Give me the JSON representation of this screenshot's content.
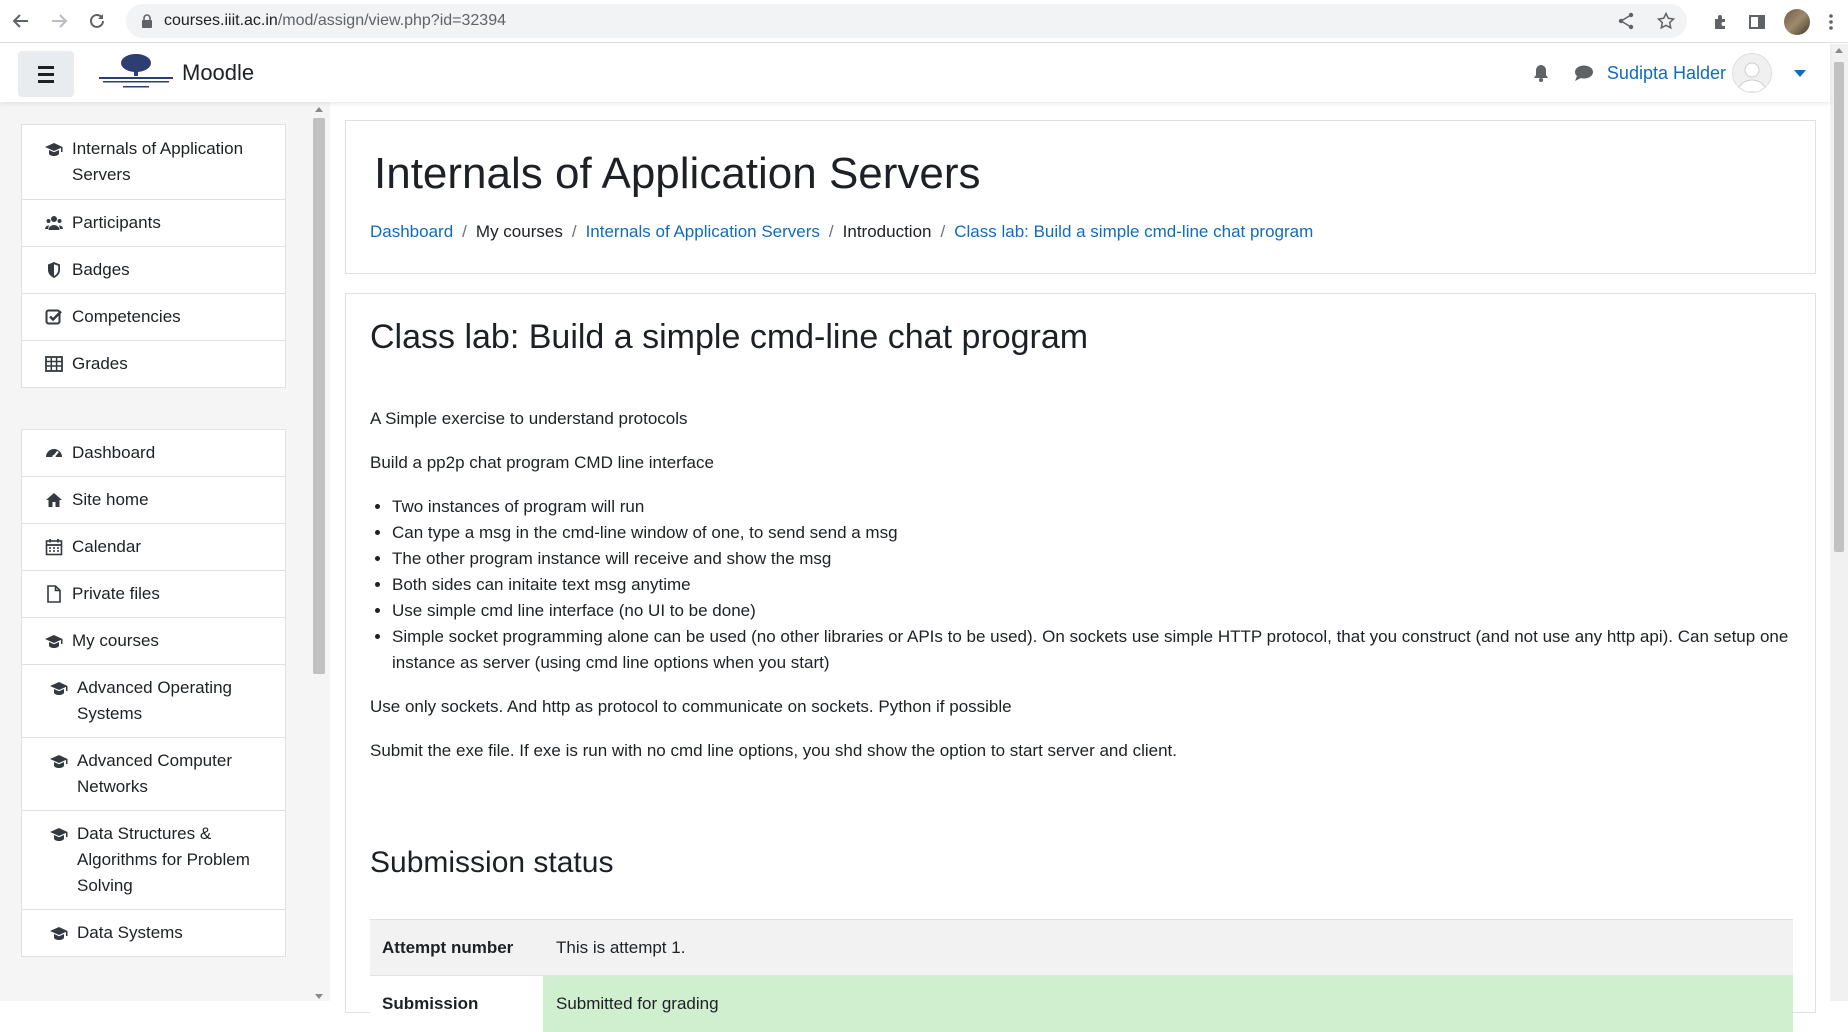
{
  "browser": {
    "url_host": "courses.iiit.ac.in",
    "url_path": "/mod/assign/view.php?id=32394"
  },
  "navbar": {
    "site_name": "Moodle",
    "user_name": "Sudipta Halder"
  },
  "drawer": {
    "course_items": [
      {
        "label": "Internals of Application Servers",
        "icon": "graduation-cap-icon"
      },
      {
        "label": "Participants",
        "icon": "users-icon"
      },
      {
        "label": "Badges",
        "icon": "shield-icon"
      },
      {
        "label": "Competencies",
        "icon": "check-square-icon"
      },
      {
        "label": "Grades",
        "icon": "table-icon"
      }
    ],
    "site_items": [
      {
        "label": "Dashboard",
        "icon": "tachometer-icon"
      },
      {
        "label": "Site home",
        "icon": "home-icon"
      },
      {
        "label": "Calendar",
        "icon": "calendar-icon"
      },
      {
        "label": "Private files",
        "icon": "file-icon"
      },
      {
        "label": "My courses",
        "icon": "graduation-cap-icon"
      },
      {
        "label": "Advanced Operating Systems",
        "icon": "graduation-cap-icon"
      },
      {
        "label": "Advanced Computer Networks",
        "icon": "graduation-cap-icon"
      },
      {
        "label": "Data Structures & Algorithms for Problem Solving",
        "icon": "graduation-cap-icon"
      },
      {
        "label": "Data Systems",
        "icon": "graduation-cap-icon"
      }
    ]
  },
  "header": {
    "course_title": "Internals of Application Servers",
    "breadcrumb": [
      {
        "label": "Dashboard",
        "link": true
      },
      {
        "label": "My courses",
        "link": false
      },
      {
        "label": "Internals of Application Servers",
        "link": true
      },
      {
        "label": "Introduction",
        "link": false
      },
      {
        "label": "Class lab: Build a simple cmd-line chat program",
        "link": true
      }
    ]
  },
  "main": {
    "activity_title": "Class lab: Build a simple cmd-line chat program",
    "intro_p1": "A Simple exercise to understand protocols",
    "intro_p2": "Build a pp2p chat program CMD line interface",
    "bullets": [
      "Two instances of program will run",
      "Can type a msg in the cmd-line window of one, to send send a msg",
      "The other program instance will receive and show the msg",
      "Both sides can initaite text msg anytime",
      "Use simple cmd line interface (no UI to be done)",
      "Simple socket programming alone can be used (no other libraries or APIs to be used). On sockets use simple HTTP protocol, that you construct (and not use any http api). Can setup one instance as server (using cmd line options when you start)"
    ],
    "intro_p3": "Use only sockets. And http as protocol to communicate on sockets. Python if possible",
    "intro_p4": "Submit the exe file. If exe is run with no cmd line options, you shd show the option to start server and client.",
    "submission_title": "Submission status",
    "status_rows": [
      {
        "label": "Attempt number",
        "value": "This is attempt 1."
      },
      {
        "label": "Submission",
        "value": "Submitted for grading"
      }
    ]
  },
  "colors": {
    "link": "#0f6cbf",
    "text": "#1d2125",
    "submitted_bg": "#cfefcf",
    "drawer_bg": "#f5f5f5"
  }
}
